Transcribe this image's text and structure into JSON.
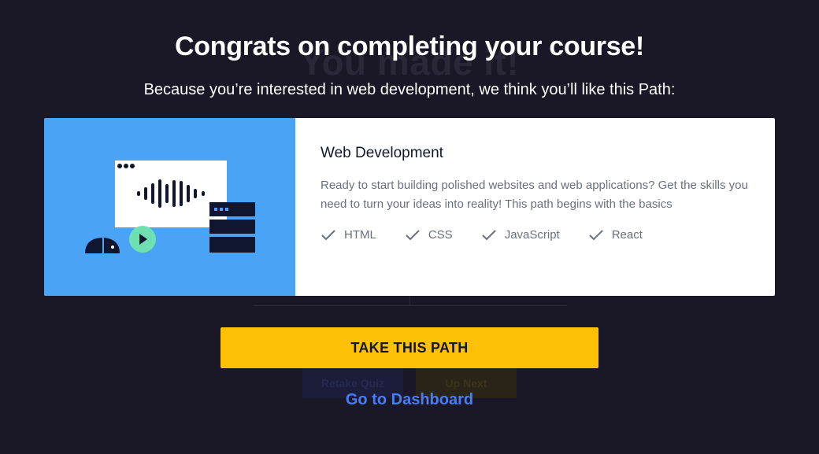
{
  "background_page": {
    "title": "You made it!",
    "retake_label": "Retake Quiz",
    "next_label": "Up Next"
  },
  "modal": {
    "heading": "Congrats on completing your course!",
    "subheading": "Because you’re interested in web development, we think you’ll like this Path:"
  },
  "card": {
    "title": "Web Development",
    "description": "Ready to start building polished websites and web applications? Get the skills you need to turn your ideas into reality! This path begins with the basics",
    "skills": [
      "HTML",
      "CSS",
      "JavaScript",
      "React"
    ],
    "image_bg_color": "#4aa3f5"
  },
  "cta": {
    "label": "TAKE THIS PATH",
    "color": "#ffc107"
  },
  "dashboard_link": {
    "label": "Go to Dashboard",
    "color": "#4a7cf7"
  }
}
